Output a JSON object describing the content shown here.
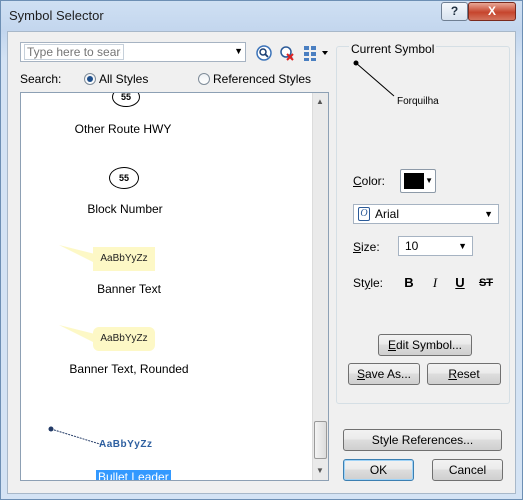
{
  "window": {
    "title": "Symbol Selector",
    "help_label": "?",
    "close_label": "X"
  },
  "search": {
    "placeholder": "Type here to search",
    "label": "Search:",
    "scope_all": "All Styles",
    "scope_referenced": "Referenced Styles",
    "selected_scope": "All Styles"
  },
  "symbols": [
    {
      "label": "Other Route HWY",
      "preview_text": "55"
    },
    {
      "label": "Block Number",
      "preview_text": "55"
    },
    {
      "label": "Banner Text",
      "preview_text": "AaBbYyZz"
    },
    {
      "label": "Banner Text, Rounded",
      "preview_text": "AaBbYyZz"
    },
    {
      "label": "Bullet Leader",
      "preview_text": "AaBbYyZz",
      "selected": true
    }
  ],
  "current_symbol": {
    "group_title": "Current Symbol",
    "preview_text": "Forquilha"
  },
  "properties": {
    "color_label": "Color:",
    "color_value": "#000000",
    "font_value": "Arial",
    "size_label": "Size:",
    "size_value": "10",
    "style_label": "Style:",
    "style_buttons": [
      "B",
      "I",
      "U",
      "ST"
    ]
  },
  "buttons": {
    "edit_symbol": "Edit Symbol...",
    "save_as": "Save As...",
    "reset": "Reset",
    "style_references": "Style References...",
    "ok": "OK",
    "cancel": "Cancel"
  },
  "colors": {
    "selection": "#3399ff",
    "banner_fill": "#fdf8c6",
    "window_frame": "#c3d6ee"
  }
}
